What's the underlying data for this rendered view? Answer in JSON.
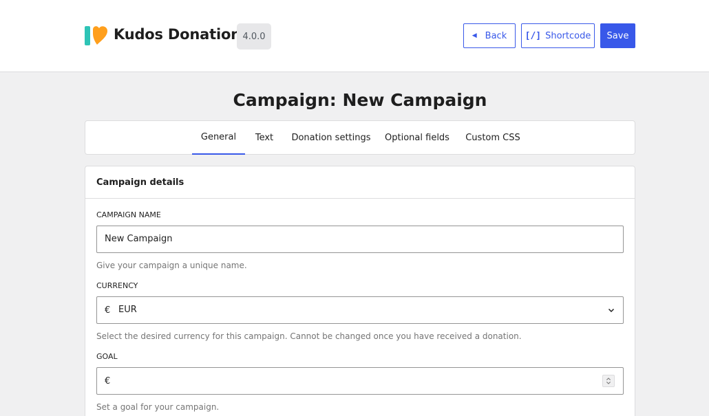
{
  "header": {
    "brand": "Kudos Donations",
    "version": "4.0.0",
    "back_label": "Back",
    "shortcode_label": "Shortcode",
    "shortcode_icon_text": "[/]",
    "save_label": "Save",
    "colors": {
      "accent": "#3858e9",
      "logo_teal": "#2ec4b6",
      "logo_orange": "#ff9f1c"
    }
  },
  "page": {
    "title": "Campaign: New Campaign"
  },
  "tabs": [
    {
      "label": "General",
      "active": true
    },
    {
      "label": "Text",
      "active": false
    },
    {
      "label": "Donation settings",
      "active": false
    },
    {
      "label": "Optional fields",
      "active": false
    },
    {
      "label": "Custom CSS",
      "active": false
    }
  ],
  "section": {
    "title": "Campaign details",
    "campaign_name": {
      "label": "CAMPAIGN NAME",
      "value": "New Campaign",
      "help": "Give your campaign a unique name."
    },
    "currency": {
      "label": "CURRENCY",
      "symbol": "€",
      "value": "EUR",
      "help": "Select the desired currency for this campaign. Cannot be changed once you have received a donation."
    },
    "goal": {
      "label": "GOAL",
      "symbol": "€",
      "value": "",
      "help": "Set a goal for your campaign."
    }
  }
}
